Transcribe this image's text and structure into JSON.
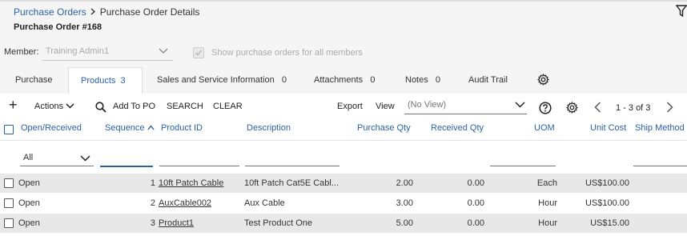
{
  "breadcrumb": {
    "parent": "Purchase Orders",
    "current": "Purchase Order Details"
  },
  "page_title": "Purchase Order #168",
  "member": {
    "label": "Member:",
    "value": "Training Admin1"
  },
  "show_all": {
    "label": "Show purchase orders for all members",
    "checked": true
  },
  "tabs": [
    {
      "label": "Purchase",
      "count": ""
    },
    {
      "label": "Products",
      "count": "3"
    },
    {
      "label": "Sales and Service Information",
      "count": "0"
    },
    {
      "label": "Attachments",
      "count": "0"
    },
    {
      "label": "Notes",
      "count": "0"
    },
    {
      "label": "Audit Trail",
      "count": ""
    }
  ],
  "toolbar": {
    "add_label": "+",
    "actions_label": "Actions",
    "add_to_po_label": "Add To PO",
    "search_label": "SEARCH",
    "clear_label": "CLEAR",
    "export_label": "Export",
    "view_label": "View",
    "view_value": "(No View)",
    "pager_text": "1 - 3 of 3"
  },
  "columns": {
    "open_received": "Open/Received",
    "sequence": "Sequence",
    "product_id": "Product ID",
    "description": "Description",
    "purchase_qty": "Purchase Qty",
    "received_qty": "Received Qty",
    "uom": "UOM",
    "unit_cost": "Unit Cost",
    "ship_method": "Ship Method"
  },
  "filters": {
    "open_received": "All"
  },
  "rows": [
    {
      "status": "Open",
      "sequence": "1",
      "product_id": "10ft Patch Cable",
      "description": "10ft Patch Cat5E Cabl...",
      "purchase_qty": "2.00",
      "received_qty": "0.00",
      "uom": "Each",
      "unit_cost": "US$100.00"
    },
    {
      "status": "Open",
      "sequence": "2",
      "product_id": "AuxCable002",
      "description": "Aux Cable",
      "purchase_qty": "3.00",
      "received_qty": "0.00",
      "uom": "Hour",
      "unit_cost": "US$100.00"
    },
    {
      "status": "Open",
      "sequence": "3",
      "product_id": "Product1",
      "description": "Test Product One",
      "purchase_qty": "5.00",
      "received_qty": "0.00",
      "uom": "Hour",
      "unit_cost": "US$15.00"
    }
  ],
  "colors": {
    "accent": "#2a62a6",
    "row_alt": "#e8e8e8",
    "page_bg": "#f5f5f5"
  }
}
